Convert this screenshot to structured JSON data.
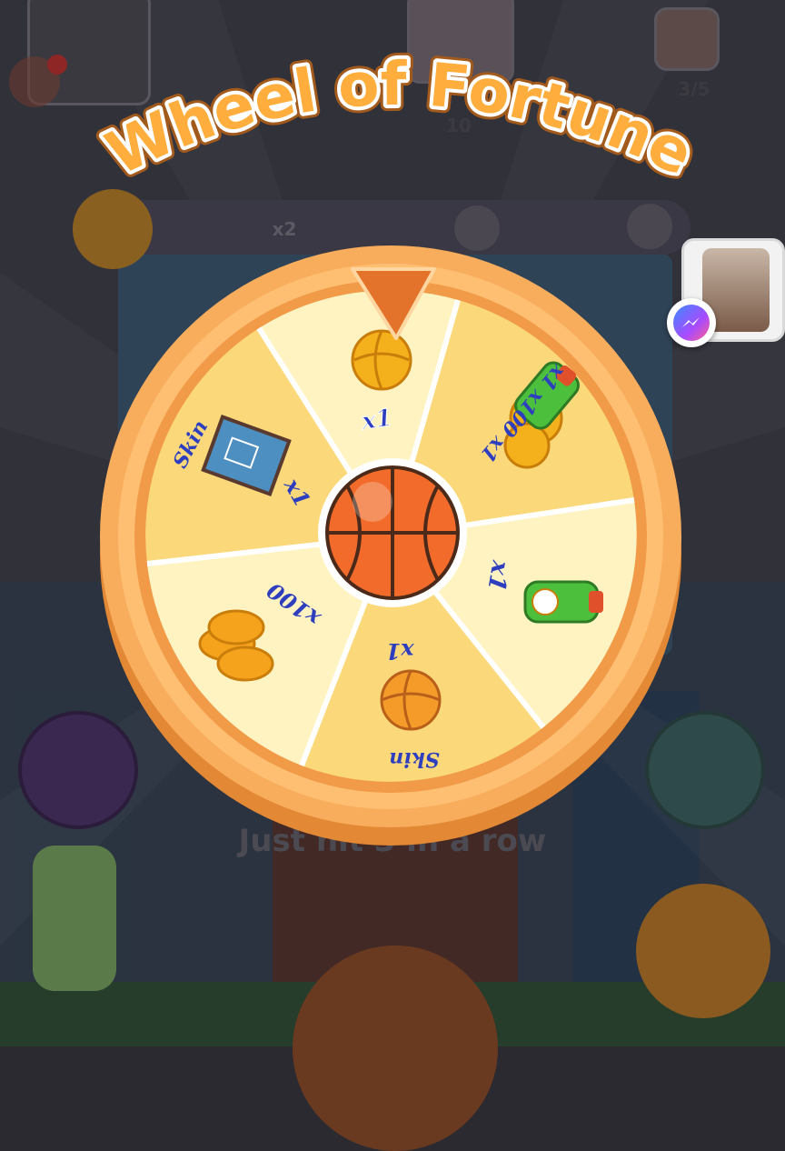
{
  "title": "Wheel of Fortune",
  "hud": {
    "level_counter": "3/5",
    "round_number": "10",
    "boost_multiplier": "x2"
  },
  "hint": "Just hit 3 in a row",
  "wheel": {
    "segments": [
      {
        "label": "x1",
        "reward": "coin"
      },
      {
        "label": "x1 x100 x1",
        "reward": "coins and bottle bundle"
      },
      {
        "label": "x1",
        "reward": "bottle"
      },
      {
        "label": "Skin",
        "sub_label": "x1",
        "reward": "orange ball skin"
      },
      {
        "label": "x100",
        "reward": "coin stack"
      },
      {
        "label": "Skin",
        "sub_label": "x1",
        "reward": "court skin"
      }
    ],
    "center_icon": "basketball-icon",
    "pointer_icon": "triangle-pointer-icon"
  },
  "colors": {
    "wheel_rim": "#f7a550",
    "segment_light": "#fff3c2",
    "segment_dark": "#fbd97a",
    "label_blue": "#2d3fbf",
    "title_fill": "#ffb347"
  }
}
